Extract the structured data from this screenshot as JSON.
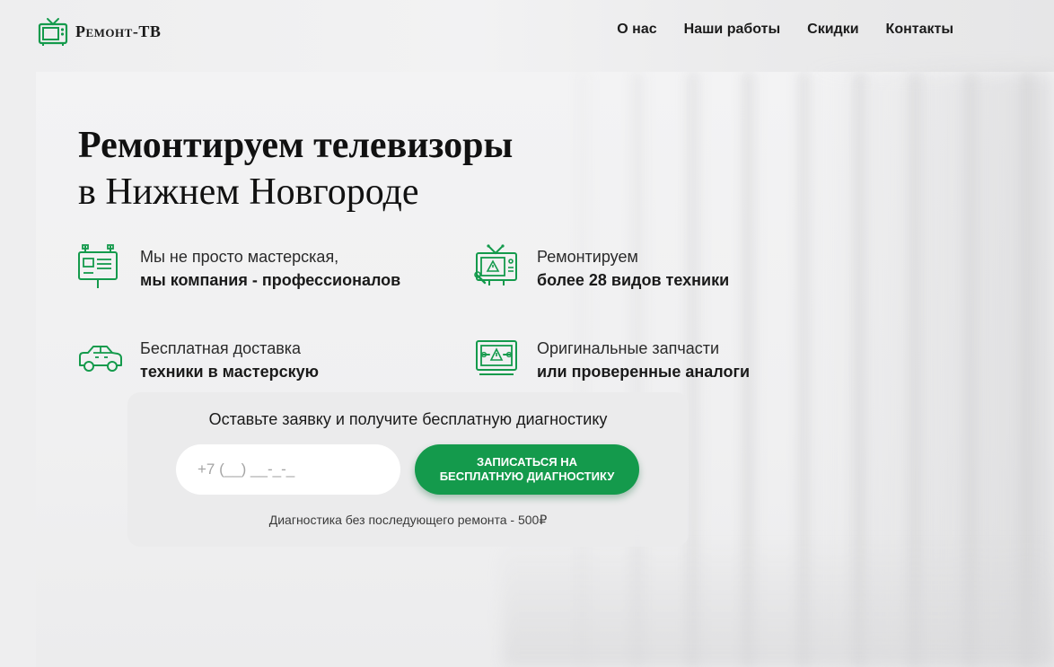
{
  "brand": {
    "name": "Ремонт-ТВ",
    "accent_color": "#149a4c",
    "logo_icon": "tv-icon"
  },
  "nav": {
    "items": [
      {
        "label": "О нас"
      },
      {
        "label": "Наши работы"
      },
      {
        "label": "Скидки"
      },
      {
        "label": "Контакты"
      }
    ]
  },
  "hero": {
    "title": "Ремонтируем телевизоры",
    "subtitle": "в Нижнем Новгороде"
  },
  "features": [
    {
      "icon": "billboard-icon",
      "line1": "Мы не просто мастерская,",
      "line2": "мы компания - профессионалов"
    },
    {
      "icon": "tv-repair-icon",
      "line1": "Ремонтируем",
      "line2": "более 28 видов техники"
    },
    {
      "icon": "delivery-car-icon",
      "line1": "Бесплатная доставка",
      "line2": "техники в мастерскую"
    },
    {
      "icon": "tv-parts-icon",
      "line1": "Оригинальные запчасти",
      "line2": "или проверенные аналоги"
    }
  ],
  "form": {
    "title": "Оставьте заявку и получите бесплатную диагностику",
    "phone_placeholder": "+7 (__) __-_-_",
    "button_line1": "Записаться на",
    "button_line2": "бесплатную диагностику",
    "note": "Диагностика без последующего ремонта - 500₽"
  }
}
